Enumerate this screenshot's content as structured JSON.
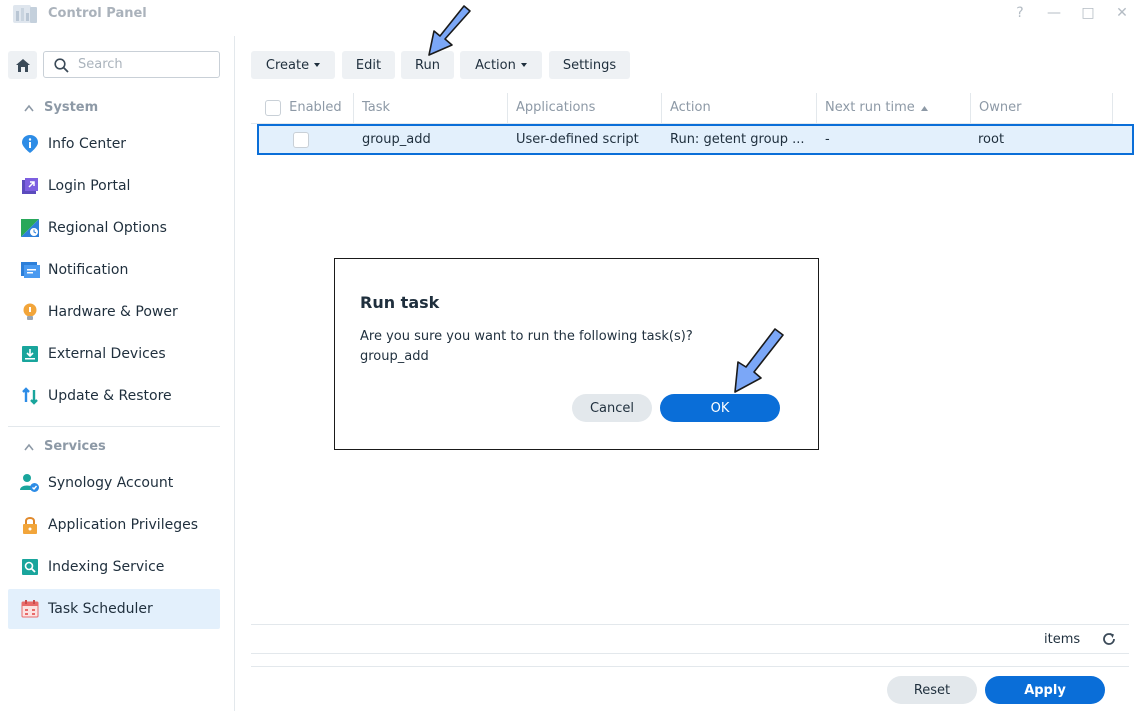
{
  "window": {
    "title": "Control Panel",
    "controls": [
      "?",
      "—",
      "□",
      "✕"
    ]
  },
  "sidebar": {
    "search_placeholder": "Search",
    "sections": [
      {
        "label": "System",
        "items": [
          {
            "label": "Info Center",
            "icon": "info-icon"
          },
          {
            "label": "Login Portal",
            "icon": "login-portal-icon"
          },
          {
            "label": "Regional Options",
            "icon": "regional-options-icon"
          },
          {
            "label": "Notification",
            "icon": "notification-icon"
          },
          {
            "label": "Hardware & Power",
            "icon": "hardware-power-icon"
          },
          {
            "label": "External Devices",
            "icon": "external-devices-icon"
          },
          {
            "label": "Update & Restore",
            "icon": "update-restore-icon"
          }
        ]
      },
      {
        "label": "Services",
        "items": [
          {
            "label": "Synology Account",
            "icon": "synology-account-icon"
          },
          {
            "label": "Application Privileges",
            "icon": "lock-icon"
          },
          {
            "label": "Indexing Service",
            "icon": "indexing-service-icon"
          },
          {
            "label": "Task Scheduler",
            "icon": "calendar-icon",
            "active": true
          }
        ]
      }
    ]
  },
  "toolbar": {
    "create": "Create",
    "edit": "Edit",
    "run": "Run",
    "action": "Action",
    "settings": "Settings"
  },
  "grid": {
    "columns": [
      "Enabled",
      "Task",
      "Applications",
      "Action",
      "Next run time",
      "Owner"
    ],
    "rows": [
      {
        "enabled": false,
        "task": "group_add",
        "applications": "User-defined script",
        "action": "Run: getent group ...",
        "next_run_time": "-",
        "owner": "root"
      }
    ]
  },
  "footer": {
    "items_label": "items",
    "reset": "Reset",
    "apply": "Apply"
  },
  "dialog": {
    "title": "Run task",
    "message": "Are you sure you want to run the following task(s)?",
    "task": "group_add",
    "cancel": "Cancel",
    "ok": "OK"
  },
  "colors": {
    "accent": "#0a6ed8",
    "selection": "#e3f0fc",
    "pointer_arrow": "#7ba7f7"
  }
}
